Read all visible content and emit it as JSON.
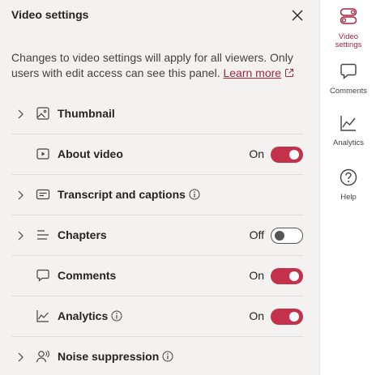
{
  "header": {
    "title": "Video settings"
  },
  "description": {
    "text": "Changes to video settings will apply for all viewers. Only users with edit access can see this panel.",
    "link_label": "Learn more"
  },
  "rows": [
    {
      "label": "Thumbnail",
      "expandable": true,
      "icon": "image-icon",
      "state": "",
      "toggle": null
    },
    {
      "label": "About video",
      "expandable": false,
      "icon": "play-icon",
      "state": "On",
      "toggle": "on"
    },
    {
      "label": "Transcript and captions",
      "expandable": true,
      "icon": "captions-icon",
      "info": true,
      "state": "",
      "toggle": null
    },
    {
      "label": "Chapters",
      "expandable": true,
      "icon": "chapters-icon",
      "state": "Off",
      "toggle": "off"
    },
    {
      "label": "Comments",
      "expandable": false,
      "icon": "comment-icon",
      "state": "On",
      "toggle": "on"
    },
    {
      "label": "Analytics",
      "expandable": false,
      "icon": "analytics-icon",
      "info": true,
      "state": "On",
      "toggle": "on"
    },
    {
      "label": "Noise suppression",
      "expandable": true,
      "icon": "noise-suppression-icon",
      "info": true,
      "state": "",
      "toggle": null
    }
  ],
  "rail": {
    "video_settings": "Video settings",
    "comments": "Comments",
    "analytics": "Analytics",
    "help": "Help"
  },
  "colors": {
    "accent": "#c4314b",
    "link": "#a4263f",
    "background": "#f3f2f1"
  }
}
